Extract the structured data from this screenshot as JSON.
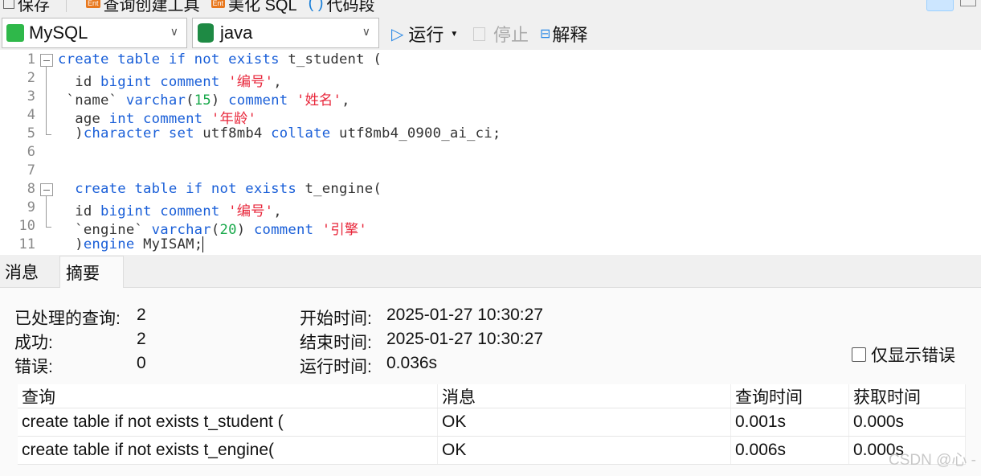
{
  "toolbar": {
    "save": "保存",
    "query_builder": "查询创建工具",
    "beautify": "美化 SQL",
    "snippet": "代码段",
    "connection": "MySQL",
    "database": "java",
    "run": "运行",
    "stop": "停止",
    "explain": "解释"
  },
  "editor": {
    "lines": [
      [
        [
          "k",
          "create table if not exists "
        ],
        [
          "p",
          "t_student ("
        ]
      ],
      [
        [
          "p",
          "  id "
        ],
        [
          "k",
          "bigint comment "
        ],
        [
          "s",
          "'编号'"
        ],
        [
          "p",
          ","
        ]
      ],
      [
        [
          "p",
          " `name` "
        ],
        [
          "k",
          "varchar"
        ],
        [
          "p",
          "("
        ],
        [
          "n",
          "15"
        ],
        [
          "p",
          ") "
        ],
        [
          "k",
          "comment "
        ],
        [
          "s",
          "'姓名'"
        ],
        [
          "p",
          ","
        ]
      ],
      [
        [
          "p",
          "  age "
        ],
        [
          "k",
          "int comment "
        ],
        [
          "s",
          "'年龄'"
        ]
      ],
      [
        [
          "p",
          "  )"
        ],
        [
          "k",
          "character set "
        ],
        [
          "p",
          "utf8mb4 "
        ],
        [
          "k",
          "collate "
        ],
        [
          "p",
          "utf8mb4_0900_ai_ci;"
        ]
      ],
      [],
      [],
      [
        [
          "p",
          "  "
        ],
        [
          "k",
          "create table if not exists "
        ],
        [
          "p",
          "t_engine("
        ]
      ],
      [
        [
          "p",
          "  id "
        ],
        [
          "k",
          "bigint comment "
        ],
        [
          "s",
          "'编号'"
        ],
        [
          "p",
          ","
        ]
      ],
      [
        [
          "p",
          "  `engine` "
        ],
        [
          "k",
          "varchar"
        ],
        [
          "p",
          "("
        ],
        [
          "n",
          "20"
        ],
        [
          "p",
          ") "
        ],
        [
          "k",
          "comment "
        ],
        [
          "s",
          "'引擎'"
        ]
      ],
      [
        [
          "p",
          "  )"
        ],
        [
          "k",
          "engine "
        ],
        [
          "p",
          "MyISAM;"
        ]
      ]
    ]
  },
  "tabs": [
    "消息",
    "摘要"
  ],
  "summary": {
    "processed_label": "已处理的查询:",
    "processed": "2",
    "success_label": "成功:",
    "success": "2",
    "error_label": "错误:",
    "error": "0",
    "start_label": "开始时间:",
    "start": "2025-01-27 10:30:27",
    "end_label": "结束时间:",
    "end": "2025-01-27 10:30:27",
    "run_label": "运行时间:",
    "run": "0.036s",
    "only_errors": "仅显示错误"
  },
  "table": {
    "headers": [
      "查询",
      "消息",
      "查询时间",
      "获取时间"
    ],
    "rows": [
      [
        "create table if not exists t_student (",
        "OK",
        "0.001s",
        "0.000s"
      ],
      [
        "create table if not exists t_engine(",
        "OK",
        "0.006s",
        "0.000s"
      ]
    ]
  },
  "watermark": "CSDN @心 -"
}
